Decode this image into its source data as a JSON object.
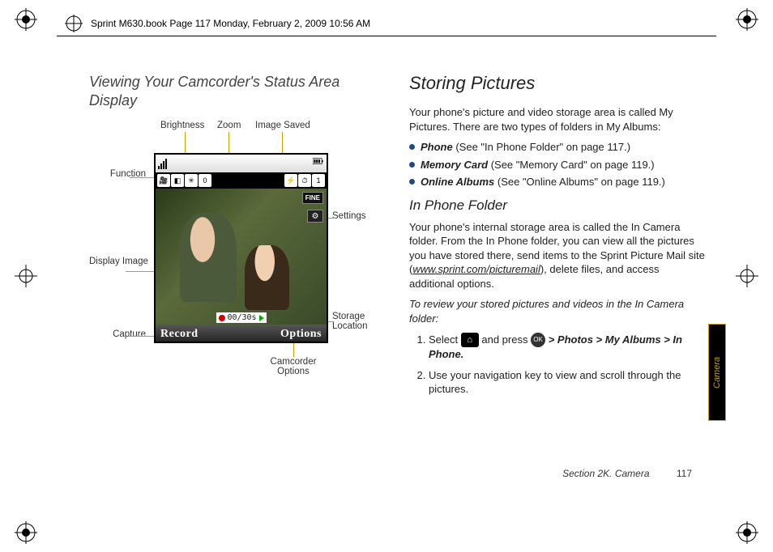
{
  "book_header": "Sprint M630.book  Page 117  Monday, February 2, 2009  10:56 AM",
  "side_tab": "Camera",
  "footer": {
    "section": "Section 2K. Camera",
    "page": "117"
  },
  "left": {
    "heading": "Viewing Your Camcorder's Status Area Display",
    "labels": {
      "brightness": "Brightness",
      "zoom": "Zoom",
      "image_saved": "Image Saved",
      "function": "Function",
      "settings": "Settings",
      "display_image": "Display Image",
      "storage_location": "Storage Location",
      "capture": "Capture",
      "camcorder_options": "Camcorder Options"
    },
    "screen": {
      "zoom_value": "0",
      "count_value": "1",
      "fine": "FINE",
      "time": "00/30s",
      "softkey_left": "Record",
      "softkey_right": "Options"
    }
  },
  "right": {
    "heading": "Storing Pictures",
    "intro": "Your phone's picture and video storage area is called My Pictures. There are two types of folders in My Albums:",
    "bullets": [
      {
        "term": "Phone",
        "rest": " (See \"In Phone Folder\" on page 117.)"
      },
      {
        "term": "Memory Card",
        "rest": " (See \"Memory Card\" on page 119.)"
      },
      {
        "term": "Online Albums",
        "rest": " (See \"Online Albums\" on page 119.)"
      }
    ],
    "sub_heading": "In Phone Folder",
    "sub_para1_a": "Your phone's internal storage area is called the In Camera folder. From the In Phone folder, you can view all the pictures you have stored there, send items to the Sprint Picture Mail site (",
    "sub_para1_url": "www.sprint.com/picturemail",
    "sub_para1_b": "), delete files, and access additional options.",
    "procedure_title": "To review your stored pictures and videos in the In Camera folder:",
    "steps": {
      "s1_a": "Select ",
      "s1_b": " and press ",
      "s1_path": " > Photos > My Albums > In Phone.",
      "s2": "Use your navigation key to view and scroll through the pictures."
    }
  }
}
